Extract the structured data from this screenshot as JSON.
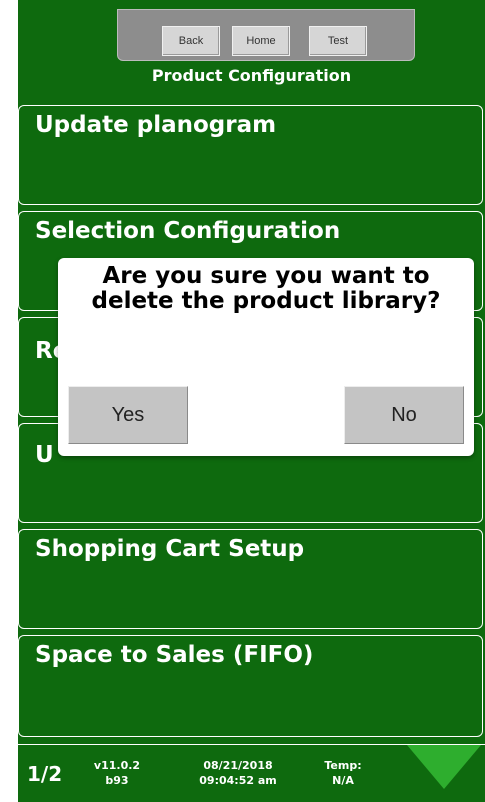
{
  "nav": {
    "back_label": "Back",
    "home_label": "Home",
    "test_label": "Test"
  },
  "page_title": "Product Configuration",
  "menu": [
    {
      "label": "Update planogram"
    },
    {
      "label": "Selection Configuration"
    },
    {
      "label": "Re"
    },
    {
      "label": "U"
    },
    {
      "label": "Shopping Cart Setup"
    },
    {
      "label": "Space to Sales (FIFO)"
    }
  ],
  "dialog": {
    "message": "Are you sure you want to delete the product library?",
    "yes_label": "Yes",
    "no_label": "No"
  },
  "footer": {
    "page_indicator": "1/2",
    "version": "v11.0.2",
    "build": "b93",
    "date": "08/21/2018",
    "time": "09:04:52 am",
    "temp_label": "Temp:",
    "temp_value": "N/A"
  },
  "colors": {
    "background": "#0e6a0e",
    "accent": "#2eae2e"
  }
}
